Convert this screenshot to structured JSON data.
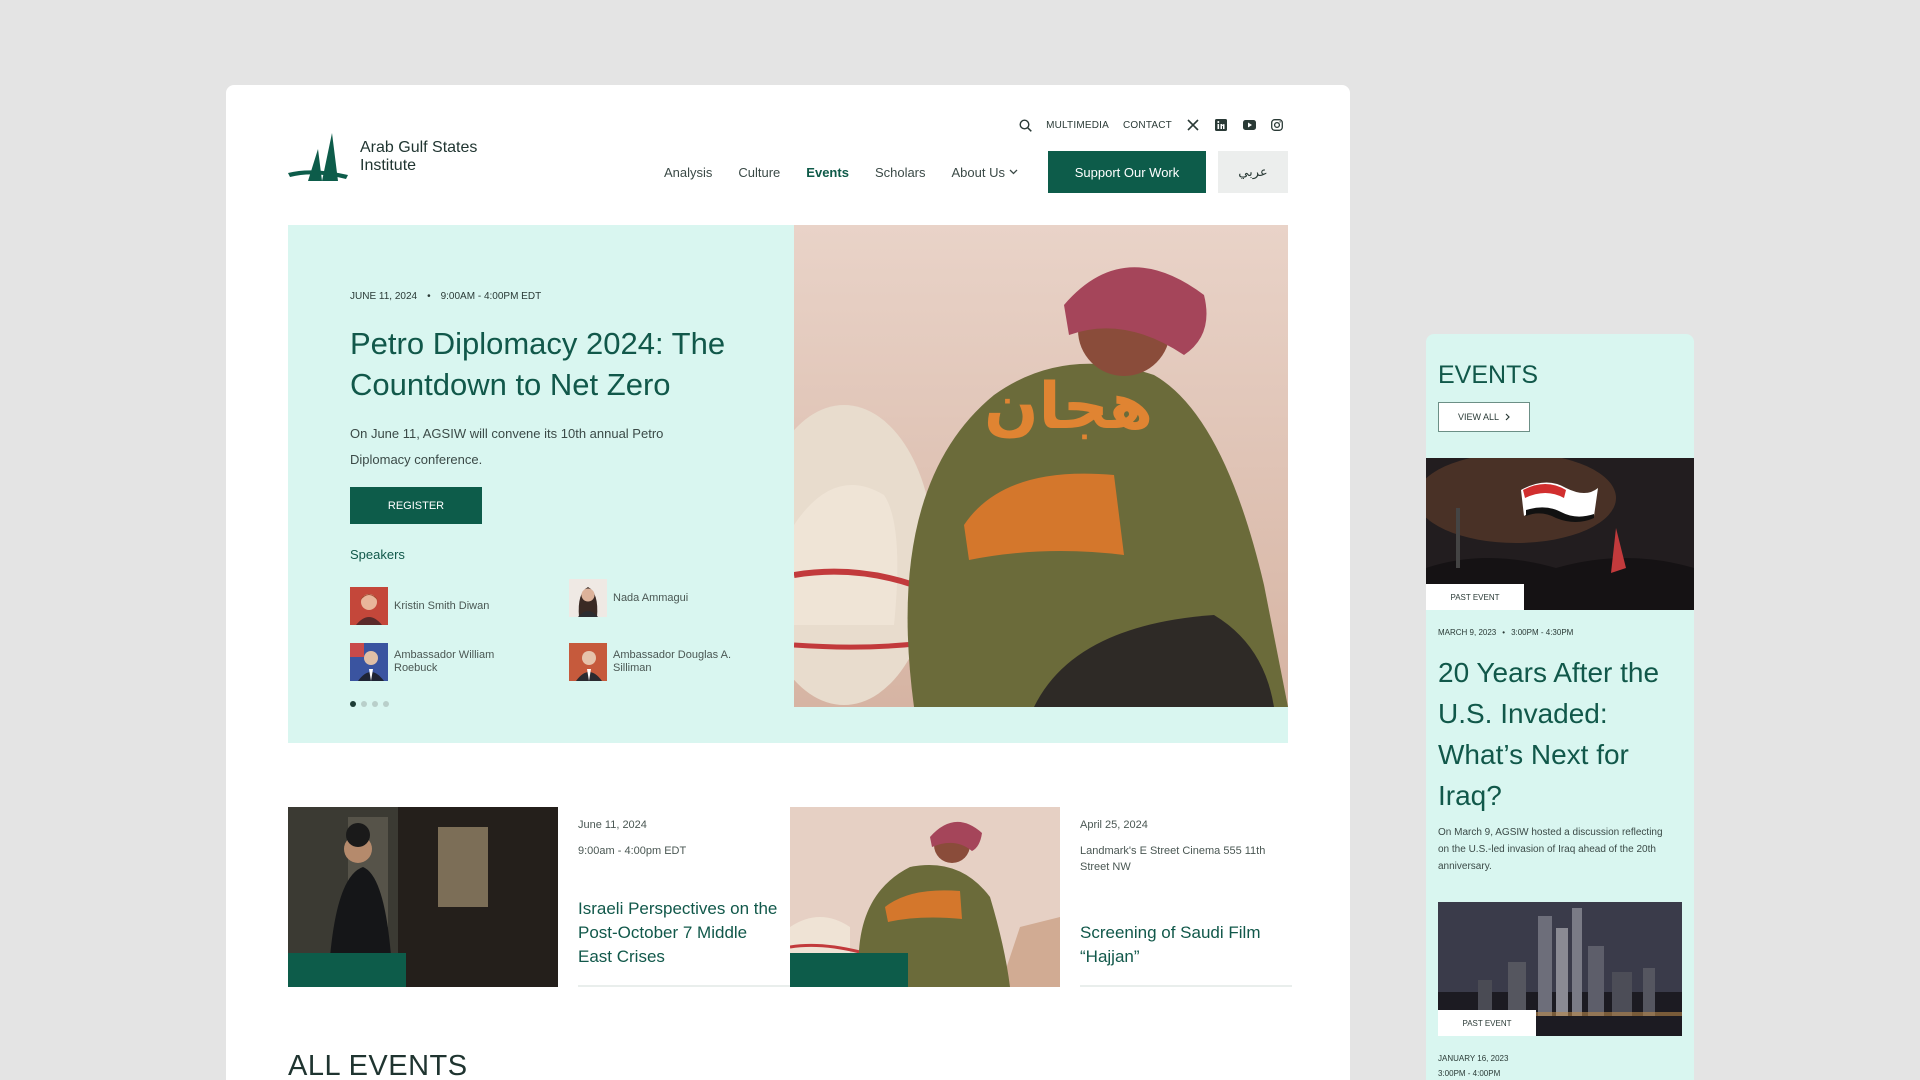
{
  "brand": {
    "name_line1": "Arab Gulf States",
    "name_line2": "Institute"
  },
  "utility_nav": {
    "multimedia": "MULTIMEDIA",
    "contact": "CONTACT"
  },
  "main_nav": {
    "items": [
      "Analysis",
      "Culture",
      "Events",
      "Scholars",
      "About Us"
    ],
    "active": "Events",
    "support_label": "Support Our Work",
    "lang_label": "عربي"
  },
  "hero": {
    "date": "JUNE 11, 2024",
    "separator": "•",
    "time": "9:00AM - 4:00PM EDT",
    "title": "Petro Diplomacy 2024: The Countdown to Net Zero",
    "description": "On June 11, AGSIW will convene its 10th annual Petro Diplomacy conference.",
    "register_label": "REGISTER",
    "speakers_label": "Speakers",
    "speakers": [
      {
        "name": "Kristin Smith Diwan"
      },
      {
        "name": "Nada Ammagui"
      },
      {
        "name": "Ambassador William Roebuck"
      },
      {
        "name": "Ambassador Douglas A. Silliman"
      }
    ],
    "image_text": "هجان"
  },
  "event_cards": [
    {
      "date": "June 11, 2024",
      "detail": "9:00am - 4:00pm EDT",
      "title": "Israeli Perspectives on the Post-October 7 Middle East Crises"
    },
    {
      "date": "April 25, 2024",
      "detail": "Landmark's E Street Cinema 555 11th Street NW",
      "title": "Screening of Saudi Film “Hajjan”"
    }
  ],
  "all_events_heading": "ALL EVENTS",
  "mobile": {
    "heading": "EVENTS",
    "view_all": "VIEW ALL",
    "badge": "PAST EVENT",
    "event1": {
      "date": "MARCH 9, 2023",
      "separator": "•",
      "time": "3:00PM - 4:30PM",
      "title": "20 Years After the U.S. Invaded: What’s Next for Iraq?",
      "description": "On March 9, AGSIW hosted a discussion reflecting on the U.S.-led invasion of Iraq ahead of the 20th anniversary."
    },
    "event2": {
      "date": "JANUARY 16, 2023",
      "time": "3:00PM - 4:00PM"
    }
  },
  "colors": {
    "brand_green": "#0d5c4a",
    "mint": "#d9f6f0",
    "page_bg": "#e4e4e4"
  }
}
